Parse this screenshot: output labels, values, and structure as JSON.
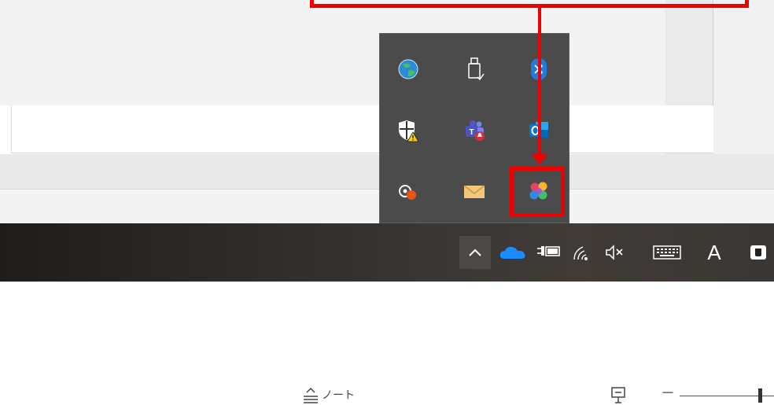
{
  "status_bar": {
    "notes_label": "ノート",
    "zoom_minus": "－"
  },
  "taskbar": {
    "ime_label": "A"
  },
  "tray_overflow": {
    "icons": [
      "network-globe-icon",
      "usb-eject-icon",
      "bluetooth-icon",
      "security-shield-icon",
      "teams-icon",
      "outlook-icon",
      "feedback-hub-icon",
      "mail-icon",
      "color-app-icon"
    ]
  },
  "tray_icons": [
    "show-hidden-icons-chevron",
    "onedrive-icon",
    "power-plug-icon",
    "wifi-icon",
    "volume-muted-icon",
    "touch-keyboard-icon",
    "ime-icon",
    "app-icon"
  ],
  "colors": {
    "annotation": "#ee0000",
    "taskbar": "#2e2a27",
    "flyout": "#4b4b4b"
  }
}
